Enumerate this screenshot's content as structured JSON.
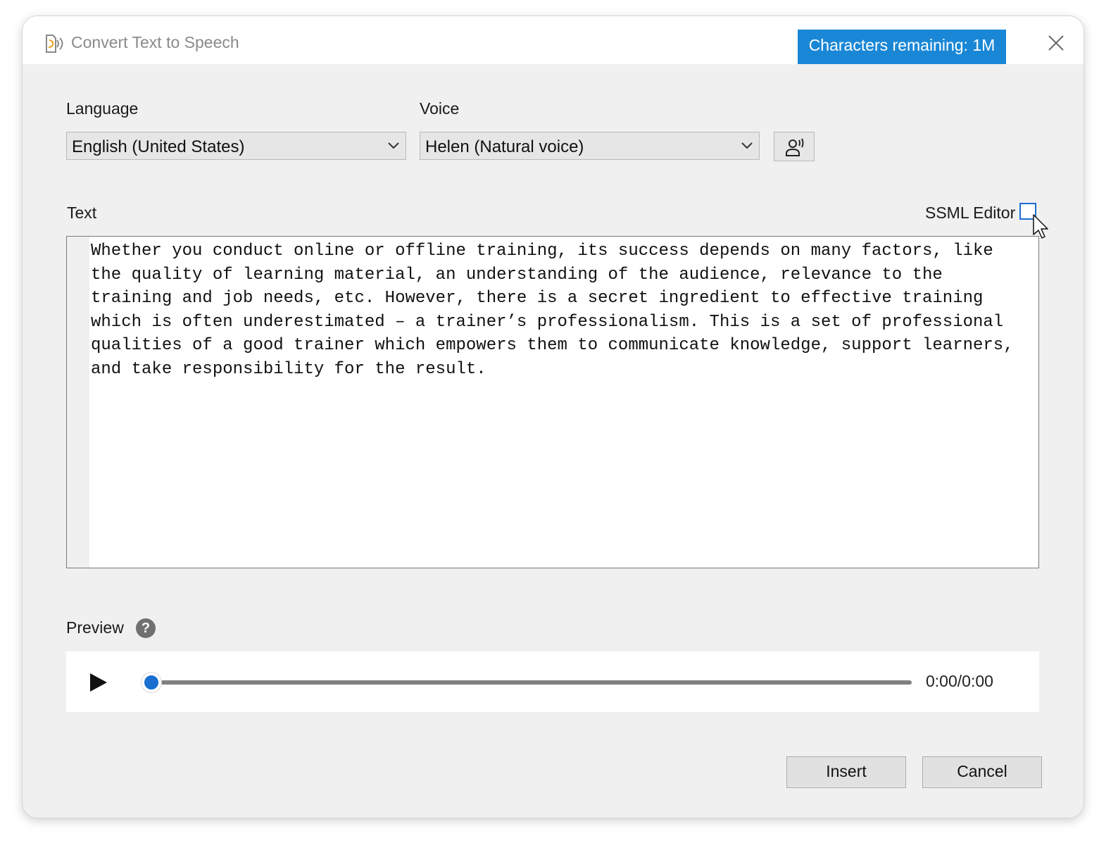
{
  "window": {
    "title": "Convert Text to Speech",
    "characters_remaining": "Characters remaining: 1M"
  },
  "language": {
    "label": "Language",
    "value": "English (United States)"
  },
  "voice": {
    "label": "Voice",
    "value": "Helen (Natural voice)"
  },
  "text": {
    "label": "Text",
    "ssml_editor_label": "SSML Editor",
    "ssml_editor_checked": false,
    "content": "Whether you conduct online or offline training, its success depends on many factors, like the quality of learning material, an understanding of the audience, relevance to the training and job needs, etc. However, there is a secret ingredient to effective training which is often underestimated – a trainer’s professionalism. This is a set of professional qualities of a good trainer which empowers them to communicate knowledge, support learners, and take responsibility for the result."
  },
  "preview": {
    "label": "Preview",
    "help_glyph": "?",
    "time": "0:00/0:00",
    "progress": 0
  },
  "buttons": {
    "insert": "Insert",
    "cancel": "Cancel"
  },
  "colors": {
    "accent": "#1a87d6",
    "checkbox": "#1a6fd1",
    "window_bg": "#f0f0f0"
  },
  "icons": {
    "app": "text-to-speech-icon",
    "close": "close-icon",
    "voice_settings": "speaking-person-icon",
    "play": "play-icon",
    "help": "help-icon",
    "dropdown": "chevron-down-icon"
  }
}
